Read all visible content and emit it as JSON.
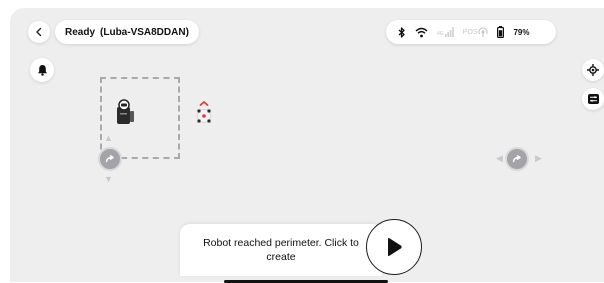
{
  "header": {
    "status_label": "Ready",
    "device_name": "(Luba-VSA8DDAN)"
  },
  "system": {
    "icons": [
      "bluetooth-icon",
      "wifi-icon",
      "cellular-4g-icon",
      "rtk-antenna-icon",
      "battery-icon"
    ],
    "cellular_label": "4G",
    "pos_label": "POS",
    "battery_text": "79%",
    "battery_percent": 79
  },
  "toast": {
    "message": "Robot reached perimeter. Click to create"
  },
  "colors": {
    "map_background": "#eeeeef",
    "perimeter_dash": "#a9a9ad",
    "marker": "#a4a4a8",
    "robot_accent": "#e53935"
  }
}
